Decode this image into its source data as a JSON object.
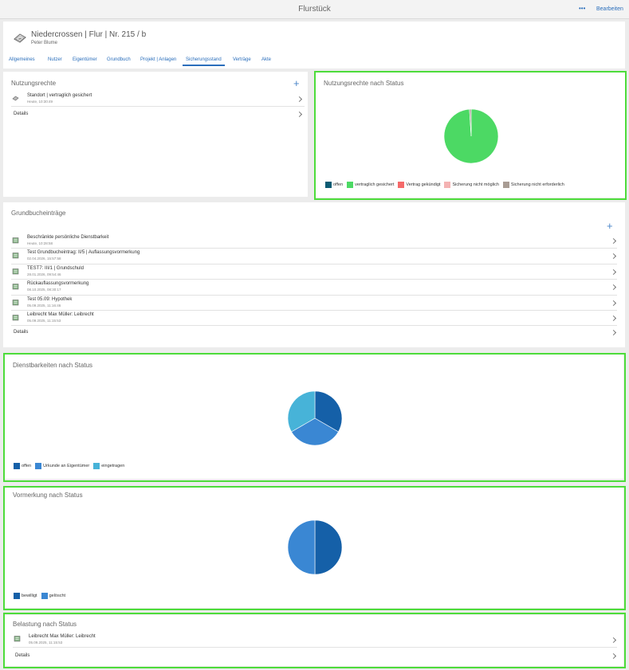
{
  "topbar": {
    "title": "Flurstück",
    "more": "•••",
    "edit_label": "Bearbeiten"
  },
  "header": {
    "title": "Niedercrossen | Flur | Nr. 215 / b",
    "subtitle": "Peter Blume",
    "icon": "parcel-icon"
  },
  "tabs": [
    {
      "label": "Allgemeines"
    },
    {
      "label": "Nutzer"
    },
    {
      "label": "Eigentümer"
    },
    {
      "label": "Grundbuch"
    },
    {
      "label": "Projekt | Anlagen"
    },
    {
      "label": "Sicherungsstand",
      "active": true
    },
    {
      "label": "Verträge"
    },
    {
      "label": "Akte"
    }
  ],
  "nutzungsrechte": {
    "title": "Nutzungsrechte",
    "items": [
      {
        "title": "Standort | vertraglich gesichert",
        "subtitle": "Heute, 10:30:49"
      }
    ],
    "details": "Details"
  },
  "nutzungsrechte_status": {
    "title": "Nutzungsrechte nach Status",
    "colors": [
      "#0d5b73",
      "#4cd964",
      "#f56a6a",
      "#f4b3b3",
      "#a99d94"
    ],
    "legend": [
      "offen",
      "vertraglich gesichert",
      "Vertrag gekündigt",
      "Sicherung nicht möglich",
      "Sicherung nicht erforderlich"
    ]
  },
  "grundbuch": {
    "title": "Grundbucheinträge",
    "items": [
      {
        "title": "Beschränkte persönliche Dienstbarkeit",
        "subtitle": "Heute, 10:28:58"
      },
      {
        "title": "Test Grundbucheintrag: II/5 | Auflassungsvormerkung",
        "subtitle": "02.04.2026, 15:57:58"
      },
      {
        "title": "TEST7: III/1 | Grundschuld",
        "subtitle": "28.01.2026, 09:54:46"
      },
      {
        "title": "Rückauflassungsvormerkung",
        "subtitle": "08.10.2025, 08:30:17"
      },
      {
        "title": "Test 05.09: Hypothek",
        "subtitle": "05.09.2025, 11:16:46"
      },
      {
        "title": "Leibrecht Max Müller: Leibrecht",
        "subtitle": "05.09.2025, 11:15:53"
      }
    ],
    "details": "Details"
  },
  "dienstbarkeiten": {
    "title": "Dienstbarkeiten nach Status",
    "colors": [
      "#1560a8",
      "#3a87d3",
      "#47b3d8"
    ],
    "legend": [
      "offen",
      "Urkunde an Eigentümer",
      "eingetragen"
    ]
  },
  "vormerkung": {
    "title": "Vormerkung nach Status",
    "colors": [
      "#1560a8",
      "#3a87d3"
    ],
    "legend": [
      "bewilligt",
      "gelöscht"
    ]
  },
  "belastung": {
    "title": "Belastung nach Status",
    "items": [
      {
        "title": "Leibrecht Max Müller: Leibrecht",
        "subtitle": "05.09.2025, 11:15:53"
      }
    ],
    "details": "Details"
  },
  "chart_data": [
    {
      "type": "pie",
      "title": "Nutzungsrechte nach Status",
      "categories": [
        "offen",
        "vertraglich gesichert",
        "Vertrag gekündigt",
        "Sicherung nicht möglich",
        "Sicherung nicht erforderlich"
      ],
      "values": [
        0,
        99,
        0,
        0,
        1
      ],
      "colors": [
        "#0d5b73",
        "#4cd964",
        "#f56a6a",
        "#f4b3b3",
        "#a99d94"
      ],
      "legend": "bottom"
    },
    {
      "type": "pie",
      "title": "Dienstbarkeiten nach Status",
      "categories": [
        "offen",
        "Urkunde an Eigentümer",
        "eingetragen"
      ],
      "values": [
        1,
        1,
        1
      ],
      "colors": [
        "#1560a8",
        "#3a87d3",
        "#47b3d8"
      ],
      "legend": "bottom"
    },
    {
      "type": "pie",
      "title": "Vormerkung nach Status",
      "categories": [
        "bewilligt",
        "gelöscht"
      ],
      "values": [
        1,
        1
      ],
      "colors": [
        "#1560a8",
        "#3a87d3"
      ],
      "legend": "bottom"
    }
  ]
}
